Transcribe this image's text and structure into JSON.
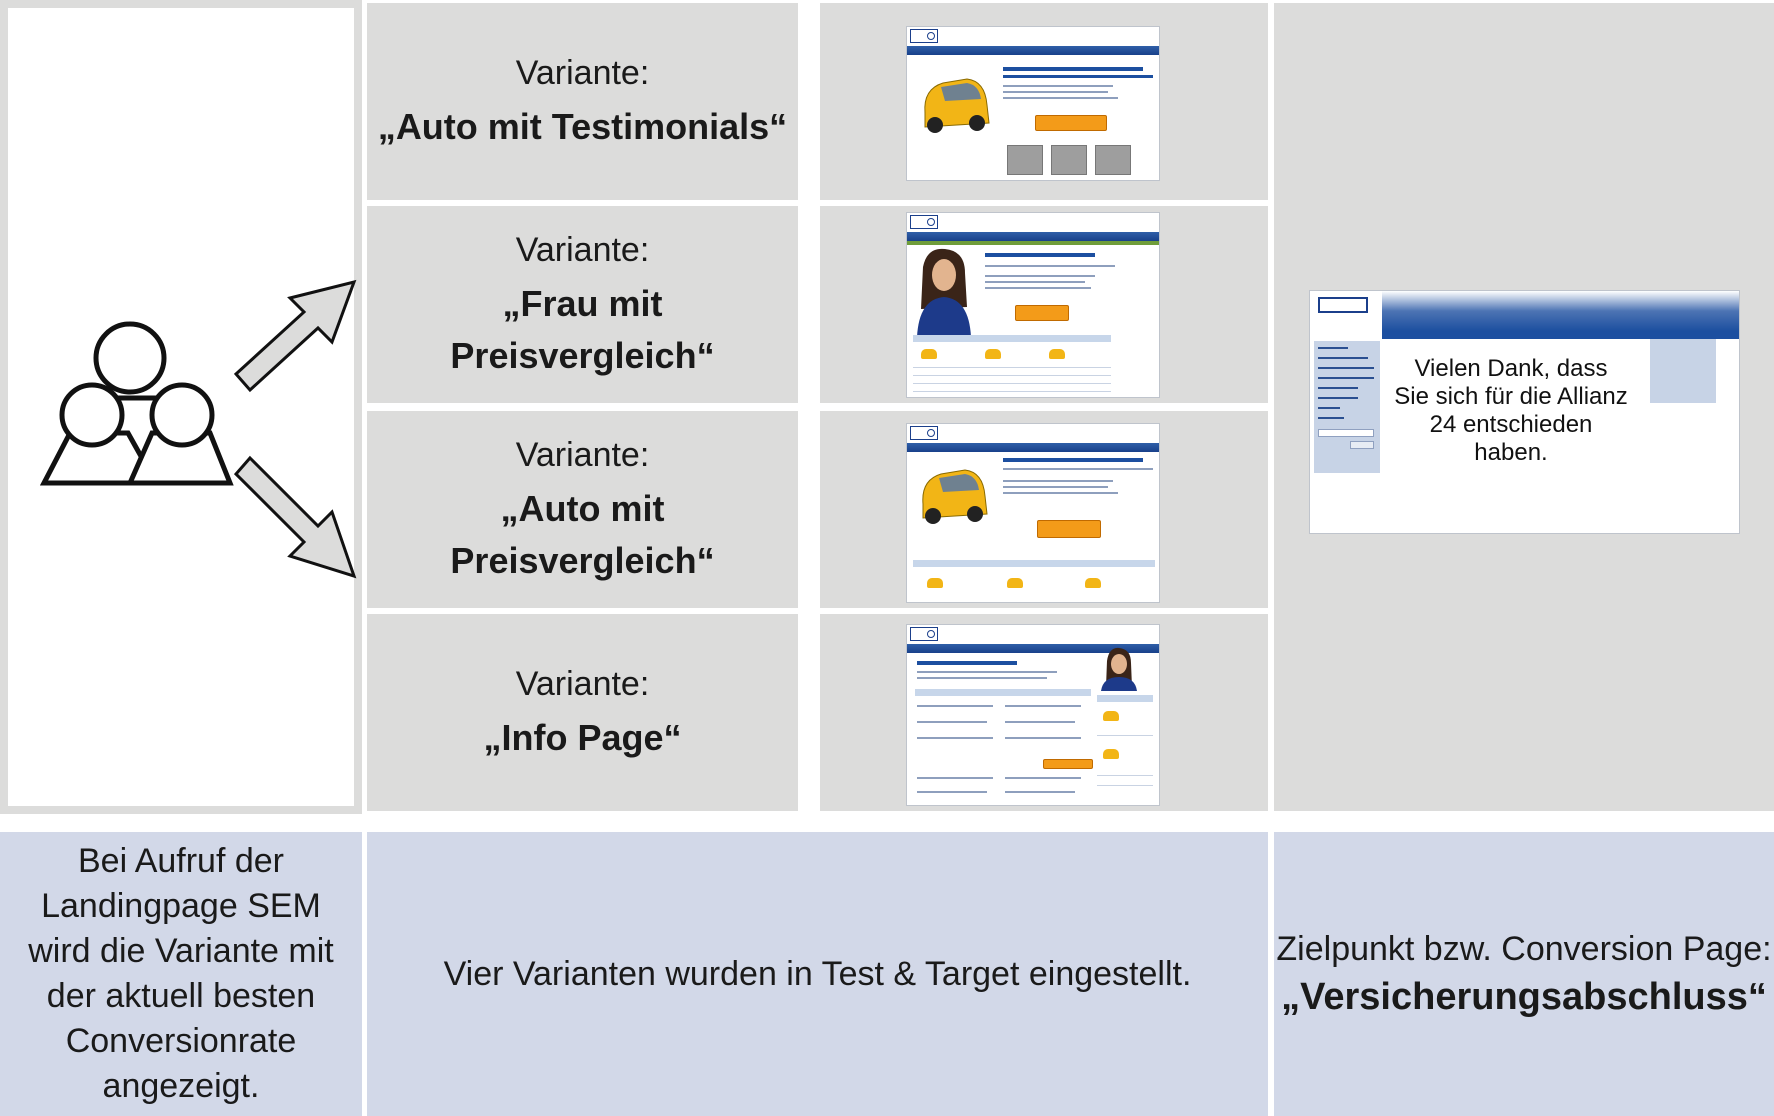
{
  "variants": [
    {
      "prefix": "Variante:",
      "name": "„Auto mit Testimonials“"
    },
    {
      "prefix": "Variante:",
      "name": "„Frau mit Preisvergleich“"
    },
    {
      "prefix": "Variante:",
      "name": "„Auto mit Preisvergleich“"
    },
    {
      "prefix": "Variante:",
      "name": "„Info Page“"
    }
  ],
  "conversion_popup": "Vielen Dank, dass Sie sich für die Allianz 24 entschieden haben.",
  "bottom": {
    "left": "Bei Aufruf der Landingpage SEM wird die Variante mit der aktuell besten Conversionrate angezeigt.",
    "middle": "Vier Varianten wurden in Test & Target eingestellt.",
    "right_line1": "Zielpunkt bzw. Conversion Page:",
    "right_line2": "„Versicherungsabschluss“"
  },
  "colors": {
    "cell_gray": "#dcdcdb",
    "cell_blue": "#d2d8e8",
    "allianz_blue": "#1c4fa0",
    "accent_orange": "#f39b19"
  },
  "icons": [
    "users-group-icon",
    "arrow-up-right-icon",
    "arrow-down-right-icon"
  ]
}
